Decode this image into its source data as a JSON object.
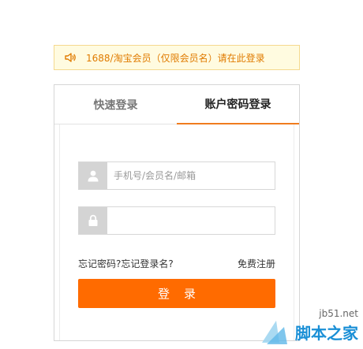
{
  "notice": {
    "text": "1688/淘宝会员（仅限会员名）请在此登录",
    "icon": "speaker-icon",
    "color": "#e07b00"
  },
  "tabs": [
    {
      "label": "快速登录",
      "active": false
    },
    {
      "label": "账户密码登录",
      "active": true
    }
  ],
  "form": {
    "username": {
      "placeholder": "手机号/会员名/邮箱",
      "value": "",
      "icon": "user-icon"
    },
    "password": {
      "placeholder": "",
      "value": "",
      "icon": "lock-icon"
    },
    "forgot_password": "忘记密码?",
    "forgot_username": "忘记登录名?",
    "register": "免费注册",
    "submit_label": "登录"
  },
  "watermark": {
    "url": "jb51.net",
    "name": "脚本之家"
  },
  "colors": {
    "accent": "#ff6b00",
    "tab_underline": "#f07c1e",
    "notice_bg": "#fffbe0"
  }
}
